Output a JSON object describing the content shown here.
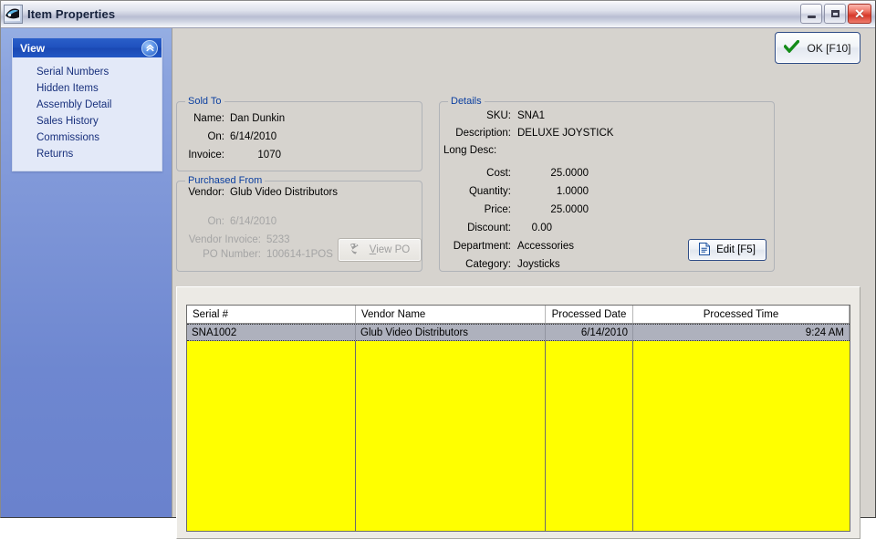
{
  "window": {
    "title": "Item Properties",
    "icon": "app-logo-icon",
    "buttons": {
      "minimize": "Minimize",
      "maximize": "Maximize",
      "close": "Close"
    }
  },
  "sidebar": {
    "header": {
      "title": "View",
      "collapse_icon": "chevron-double-up-icon"
    },
    "items": [
      {
        "label": "Serial Numbers"
      },
      {
        "label": "Hidden Items"
      },
      {
        "label": "Assembly Detail"
      },
      {
        "label": "Sales History"
      },
      {
        "label": "Commissions"
      },
      {
        "label": "Returns"
      }
    ]
  },
  "toolbar": {
    "ok_label": "OK [F10]",
    "ok_icon": "green-check-icon"
  },
  "sold_to": {
    "legend": "Sold To",
    "fields": [
      {
        "label": "Name:",
        "value": "Dan Dunkin"
      },
      {
        "label": "On:",
        "value": "6/14/2010"
      },
      {
        "label": "Invoice:",
        "value": "1070"
      }
    ]
  },
  "purchased_from": {
    "legend": "Purchased From",
    "fields": [
      {
        "label": "Vendor:",
        "value": "Glub Video Distributors",
        "disabled": false
      },
      {
        "label": "On:",
        "value": "6/14/2010",
        "disabled": true
      },
      {
        "label": "Vendor Invoice:",
        "value": "5233",
        "disabled": true
      },
      {
        "label": "PO Number:",
        "value": "100614-1POS",
        "disabled": true
      }
    ],
    "view_po_button": {
      "label_prefix": "",
      "accel": "V",
      "label_rest": "iew PO",
      "full_label": "View PO",
      "icon": "po-document-icon",
      "disabled": true
    }
  },
  "details": {
    "legend": "Details",
    "fields": [
      {
        "label": "SKU:",
        "value": "SNA1"
      },
      {
        "label": "Description:",
        "value": "DELUXE JOYSTICK"
      },
      {
        "label": "Long Desc:",
        "value": ""
      },
      {
        "label": "Cost:",
        "value": "25.0000"
      },
      {
        "label": "Quantity:",
        "value": "1.0000"
      },
      {
        "label": "Price:",
        "value": "25.0000"
      },
      {
        "label": "Discount:",
        "value": "0.00"
      },
      {
        "label": "Department:",
        "value": "Accessories"
      },
      {
        "label": "Category:",
        "value": "Joysticks"
      }
    ],
    "edit_button": {
      "label": "Edit [F5]",
      "icon": "document-edit-icon"
    }
  },
  "grid": {
    "columns": [
      {
        "header": "Serial #",
        "align": "left"
      },
      {
        "header": "Vendor Name",
        "align": "left"
      },
      {
        "header": "Processed Date",
        "align": "center"
      },
      {
        "header": "Processed Time",
        "align": "center"
      }
    ],
    "rows": [
      {
        "serial": "SNA1002",
        "vendor": "Glub Video Distributors",
        "date": "6/14/2010",
        "time": "9:24 AM",
        "selected": true
      }
    ],
    "empty_background_color": "#ffff00"
  },
  "colors": {
    "accent_blue": "#0b3fa0",
    "nav_header": "#1f51be",
    "selection": "#aeb1bd",
    "grid_empty": "#ffff00",
    "ok_check": "#148c18"
  }
}
